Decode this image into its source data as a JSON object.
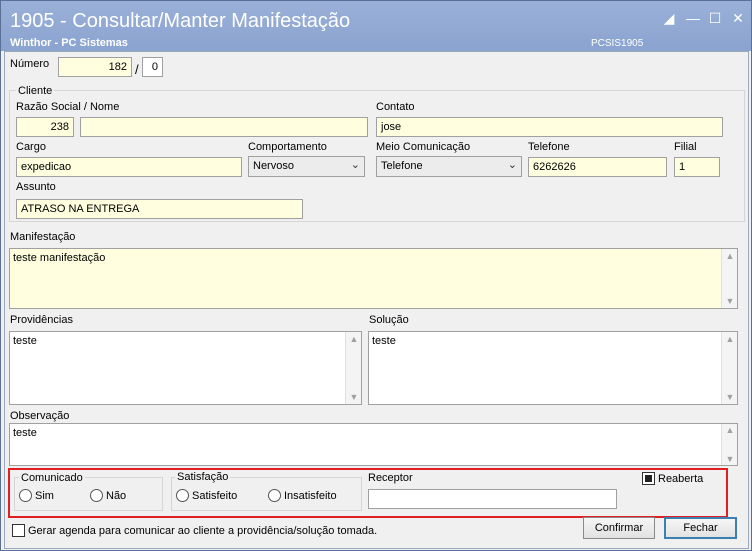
{
  "window": {
    "title": "1905 - Consultar/Manter Manifestação",
    "subtitle": "Winthor - PC Sistemas",
    "code": "PCSIS1905"
  },
  "numero": {
    "label": "Número",
    "value": "182",
    "separator": "/",
    "sequence": "0"
  },
  "cliente": {
    "group_label": "Cliente",
    "razao_label": "Razão Social / Nome",
    "codigo": "238",
    "razao_value": "",
    "contato_label": "Contato",
    "contato_value": "jose",
    "cargo_label": "Cargo",
    "cargo_value": "expedicao",
    "comportamento_label": "Comportamento",
    "comportamento_value": "Nervoso",
    "meio_label": "Meio Comunicação",
    "meio_value": "Telefone",
    "telefone_label": "Telefone",
    "telefone_value": "6262626",
    "filial_label": "Filial",
    "filial_value": "1",
    "assunto_label": "Assunto",
    "assunto_value": "ATRASO NA ENTREGA"
  },
  "manifestacao": {
    "label": "Manifestação",
    "value": "teste manifestação"
  },
  "providencias": {
    "label": "Providências",
    "value": "teste"
  },
  "solucao": {
    "label": "Solução",
    "value": "teste"
  },
  "observacao": {
    "label": "Observação",
    "value": "teste"
  },
  "comunicado": {
    "label": "Comunicado",
    "sim": "Sim",
    "nao": "Não"
  },
  "satisfacao": {
    "label": "Satisfação",
    "satisfeito": "Satisfeito",
    "insatisfeito": "Insatisfeito"
  },
  "receptor": {
    "label": "Receptor",
    "value": ""
  },
  "reaberta": {
    "label": "Reaberta",
    "checked": true
  },
  "agenda": {
    "label": "Gerar agenda para comunicar ao cliente a providência/solução tomada.",
    "checked": false
  },
  "buttons": {
    "confirmar": "Confirmar",
    "fechar": "Fechar"
  },
  "colors": {
    "titlebar": "#8aa3cf",
    "field_bg": "#ffffe0",
    "highlight": "#e02020"
  }
}
